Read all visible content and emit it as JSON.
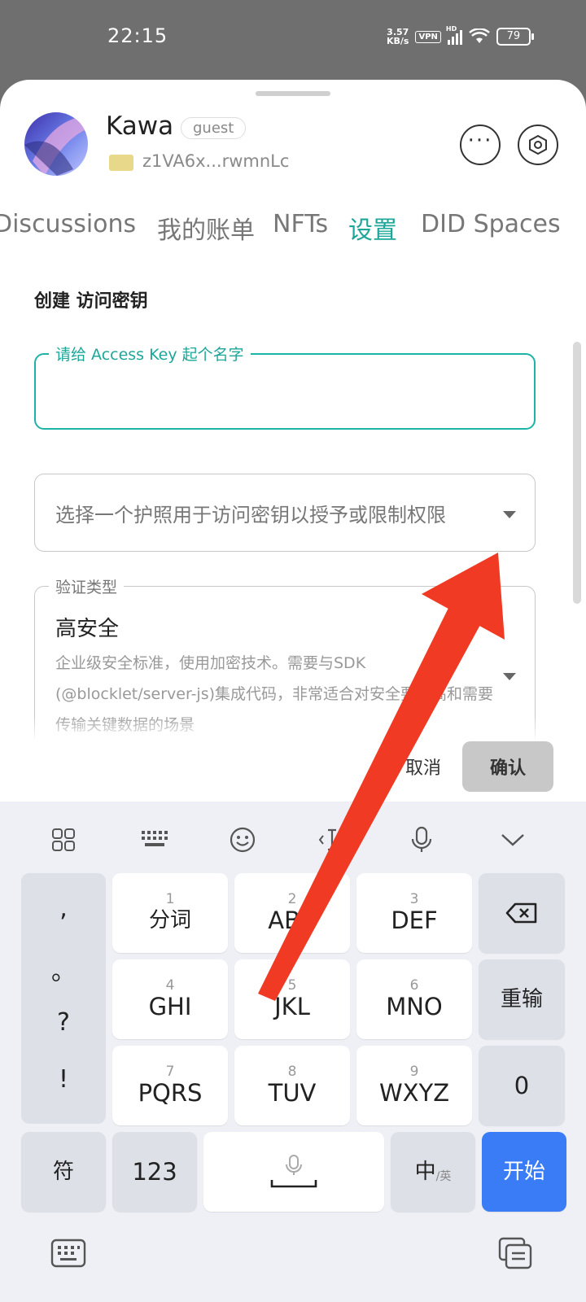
{
  "status_bar": {
    "time": "22:15",
    "net_speed_value": "3.57",
    "net_speed_unit": "KB/s",
    "vpn": "VPN",
    "hd": "HD",
    "battery": "79"
  },
  "profile": {
    "name": "Kawa",
    "role_badge": "guest",
    "did": "z1VA6x...rwmnLc"
  },
  "tabs": [
    {
      "label": "Discussions"
    },
    {
      "label": "我的账单"
    },
    {
      "label": "NFTs"
    },
    {
      "label": "设置"
    },
    {
      "label": "DID Spaces"
    }
  ],
  "active_tab": "设置",
  "form": {
    "title": "创建 访问密钥",
    "name_field_label": "请给 Access Key 起个名字",
    "name_field_value": "",
    "passport_placeholder": "选择一个护照用于访问密钥以授予或限制权限",
    "auth_type_label": "验证类型",
    "auth_type_value": "高安全",
    "auth_type_desc": "企业级安全标准，使用加密技术。需要与SDK (@blocklet/server-js)集成代码，非常适合对安全要求高和需要传输关键数据的场景",
    "cancel_label": "取消",
    "confirm_label": "确认"
  },
  "keyboard": {
    "symbols": [
      ",",
      "。",
      "?",
      "!"
    ],
    "keys": [
      {
        "num": "1",
        "label": "分词"
      },
      {
        "num": "2",
        "label": "ABC"
      },
      {
        "num": "3",
        "label": "DEF"
      },
      {
        "num": "4",
        "label": "GHI"
      },
      {
        "num": "5",
        "label": "JKL"
      },
      {
        "num": "6",
        "label": "MNO"
      },
      {
        "num": "7",
        "label": "PQRS"
      },
      {
        "num": "8",
        "label": "TUV"
      },
      {
        "num": "9",
        "label": "WXYZ"
      }
    ],
    "reset_label": "重输",
    "zero_label": "0",
    "symbol_key": "符",
    "num_key": "123",
    "lang_key": "中",
    "lang_sub": "/英",
    "start_key": "开始"
  },
  "colors": {
    "accent": "#1da69a",
    "annotation_arrow": "#f03a24",
    "start_key": "#3a7cf5"
  }
}
